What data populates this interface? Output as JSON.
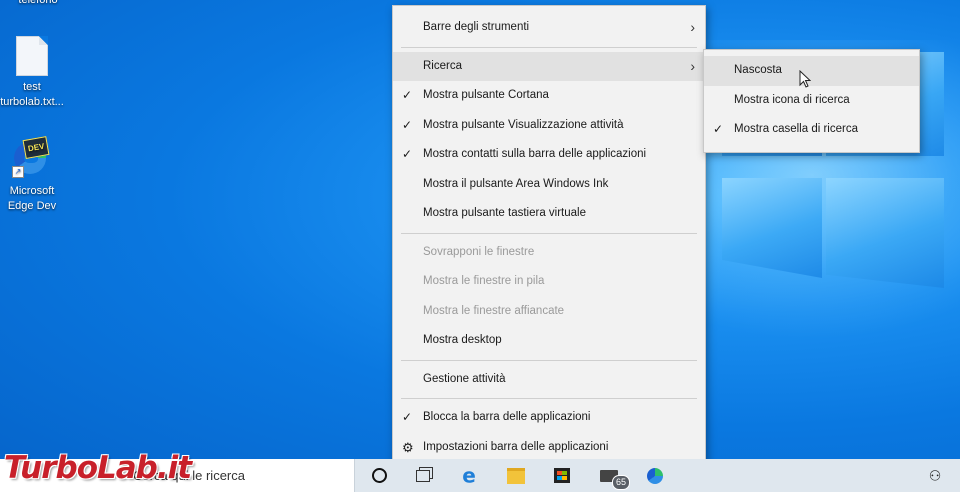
{
  "desktop_icons": [
    {
      "label": "telefono"
    },
    {
      "label": "test\nturbolab.txt..."
    },
    {
      "label": "Microsoft\nEdge Dev",
      "tag": "DEV"
    }
  ],
  "context_menu": {
    "items": [
      {
        "label": "Barre degli strumenti",
        "submenu": true,
        "checked": false,
        "disabled": false
      },
      {
        "label": "Ricerca",
        "submenu": true,
        "checked": false,
        "disabled": false,
        "hover": true
      },
      {
        "label": "Mostra pulsante Cortana",
        "checked": true
      },
      {
        "label": "Mostra pulsante Visualizzazione attività",
        "checked": true
      },
      {
        "label": "Mostra contatti sulla barra delle applicazioni",
        "checked": true
      },
      {
        "label": "Mostra il pulsante Area Windows Ink",
        "checked": false
      },
      {
        "label": "Mostra pulsante tastiera virtuale",
        "checked": false
      },
      {
        "label": "Sovrapponi le finestre",
        "disabled": true
      },
      {
        "label": "Mostra le finestre in pila",
        "disabled": true
      },
      {
        "label": "Mostra le finestre affiancate",
        "disabled": true
      },
      {
        "label": "Mostra desktop"
      },
      {
        "label": "Gestione attività"
      },
      {
        "label": "Blocca la barra delle applicazioni",
        "checked": true
      },
      {
        "label": "Impostazioni barra delle applicazioni",
        "icon": "gear-icon"
      }
    ]
  },
  "search_submenu": {
    "items": [
      {
        "label": "Nascosta",
        "hover": true,
        "checked": false
      },
      {
        "label": "Mostra icona di ricerca",
        "checked": false
      },
      {
        "label": "Mostra casella di ricerca",
        "checked": true
      }
    ]
  },
  "taskbar": {
    "search_text": "Cerca qui le ricerca",
    "mail_badge": "65",
    "icons": [
      "cortana-icon",
      "task-view-icon",
      "edge-icon",
      "file-explorer-icon",
      "store-icon",
      "mail-icon",
      "edge-dev-icon",
      "people-icon"
    ]
  },
  "watermark": {
    "part1": "Turbo",
    "part2": "Lab",
    "part3": ".it"
  }
}
